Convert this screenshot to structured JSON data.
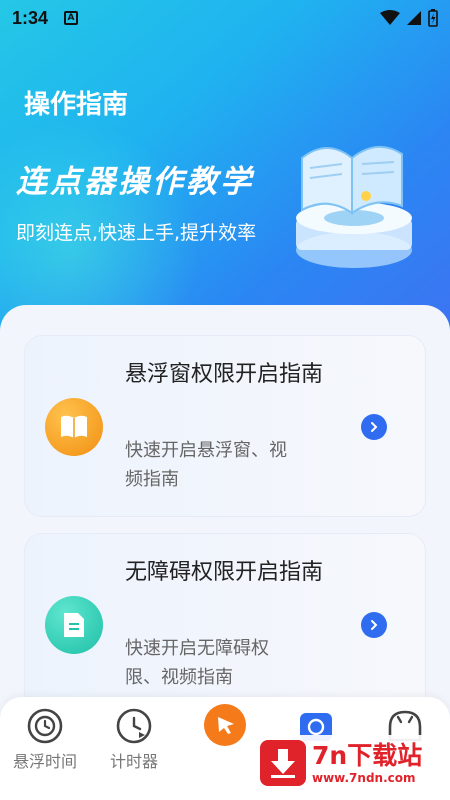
{
  "status_bar": {
    "time": "1:34",
    "notif_letter": "A"
  },
  "header": {
    "title": "操作指南",
    "heading": "连点器操作教学",
    "subtitle": "即刻连点,快速上手,提升效率"
  },
  "cards": [
    {
      "title": "悬浮窗权限开启指南",
      "desc": "快速开启悬浮窗、视频指南",
      "icon": "book-icon",
      "color": "#f6a21d"
    },
    {
      "title": "无障碍权限开启指南",
      "desc": "快速开启无障碍权限、视频指南",
      "icon": "document-icon",
      "color": "#2ecfb2"
    }
  ],
  "nav": {
    "items": [
      {
        "label": "悬浮时间",
        "icon": "clock-icon"
      },
      {
        "label": "计时器",
        "icon": "timer-icon"
      },
      {
        "label": "",
        "icon": "cursor-click-icon"
      },
      {
        "label": "",
        "icon": "camera-icon"
      },
      {
        "label": "",
        "icon": "profile-icon"
      }
    ]
  },
  "watermark": {
    "brand": "7n下载站",
    "url": "www.7ndn.com"
  },
  "colors": {
    "accent": "#2f6cf0",
    "orange": "#f57a1a",
    "hero_start": "#25c7e6",
    "hero_end": "#3d73f2"
  }
}
